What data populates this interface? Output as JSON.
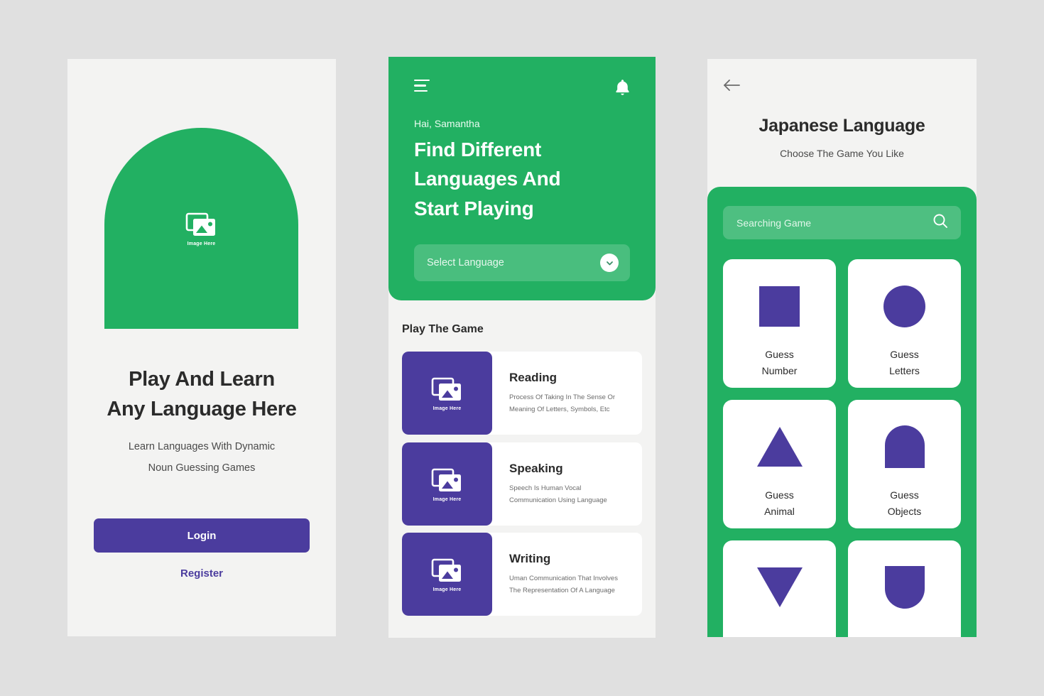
{
  "theme": {
    "green": "#22b062",
    "purple": "#4b3c9e",
    "page_background": "#e0e0e0",
    "screen_background": "#f3f3f2",
    "text_dark": "#2b2b2b"
  },
  "onboarding": {
    "hero_placeholder_label": "Image Here",
    "title_line_1": "Play And Learn",
    "title_line_2": "Any Language Here",
    "subtitle_line_1": "Learn Languages With Dynamic",
    "subtitle_line_2": "Noun Guessing Games",
    "login_label": "Login",
    "register_label": "Register"
  },
  "home": {
    "menu_icon": "hamburger-icon",
    "notification_icon": "bell-icon",
    "greeting": "Hai, Samantha",
    "heading_line_1": "Find Different",
    "heading_line_2": "Languages And",
    "heading_line_3": "Start Playing",
    "select_language_placeholder": "Select Language",
    "dropdown_icon": "chevron-down-icon",
    "section_title": "Play The Game",
    "cards": [
      {
        "thumb_label": "Image Here",
        "name": "Reading",
        "desc_line_1": "Process Of Taking In The Sense Or",
        "desc_line_2": "Meaning Of Letters, Symbols, Etc"
      },
      {
        "thumb_label": "Image Here",
        "name": "Speaking",
        "desc_line_1": "Speech Is Human Vocal",
        "desc_line_2": "Communication Using Language"
      },
      {
        "thumb_label": "Image Here",
        "name": "Writing",
        "desc_line_1": "Uman Communication That Involves",
        "desc_line_2": "The Representation Of A Language"
      }
    ]
  },
  "games": {
    "back_icon": "arrow-left-icon",
    "title": "Japanese Language",
    "subtitle": "Choose The Game You Like",
    "search_placeholder": "Searching Game",
    "search_icon": "search-icon",
    "tiles": [
      {
        "shape": "square",
        "label_line_1": "Guess",
        "label_line_2": "Number"
      },
      {
        "shape": "circle",
        "label_line_1": "Guess",
        "label_line_2": "Letters"
      },
      {
        "shape": "triangle-up",
        "label_line_1": "Guess",
        "label_line_2": "Animal"
      },
      {
        "shape": "arch",
        "label_line_1": "Guess",
        "label_line_2": "Objects"
      },
      {
        "shape": "triangle-down",
        "label_line_1": "",
        "label_line_2": ""
      },
      {
        "shape": "arch-down",
        "label_line_1": "",
        "label_line_2": ""
      }
    ]
  }
}
